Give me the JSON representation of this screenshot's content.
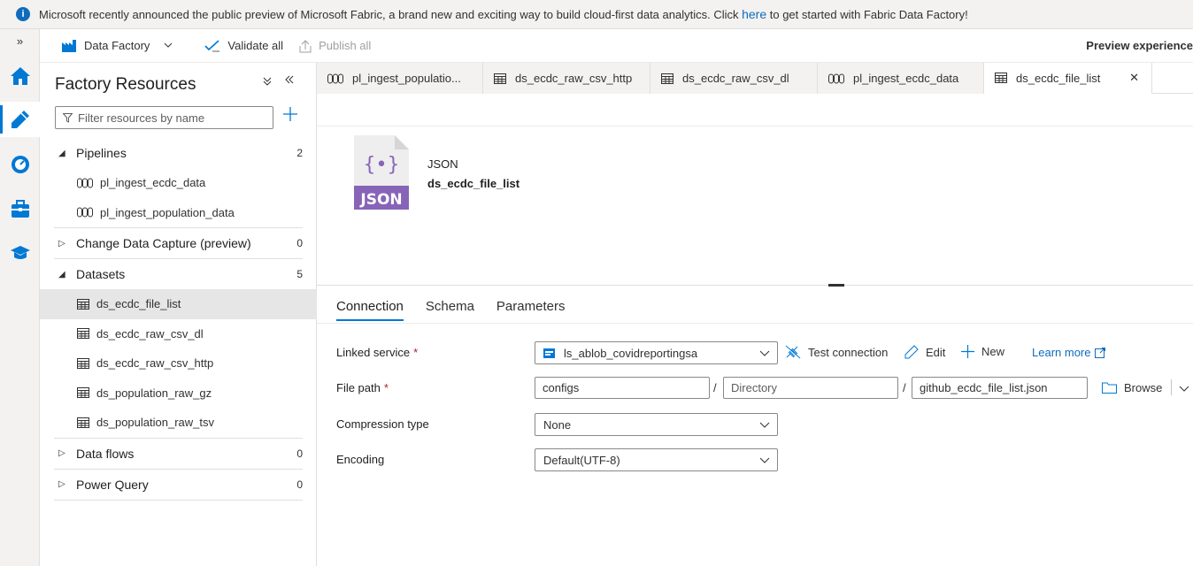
{
  "banner": {
    "text_before": "Microsoft recently announced the public preview of Microsoft Fabric, a brand new and exciting way to build cloud-first data analytics. Click ",
    "link": "here",
    "text_after": " to get started with Fabric Data Factory!"
  },
  "toolbar": {
    "factory_label": "Data Factory",
    "validate_label": "Validate all",
    "publish_label": "Publish all",
    "preview_label": "Preview experience"
  },
  "panel": {
    "title": "Factory Resources",
    "filter_placeholder": "Filter resources by name",
    "categories": [
      {
        "label": "Pipelines",
        "count": "2",
        "items": [
          "pl_ingest_ecdc_data",
          "pl_ingest_population_data"
        ]
      },
      {
        "label": "Change Data Capture (preview)",
        "count": "0"
      },
      {
        "label": "Datasets",
        "count": "5",
        "items": [
          "ds_ecdc_file_list",
          "ds_ecdc_raw_csv_dl",
          "ds_ecdc_raw_csv_http",
          "ds_population_raw_gz",
          "ds_population_raw_tsv"
        ]
      },
      {
        "label": "Data flows",
        "count": "0"
      },
      {
        "label": "Power Query",
        "count": "0"
      }
    ]
  },
  "tabs": [
    {
      "label": "pl_ingest_populatio...",
      "icon": "pipeline-icon"
    },
    {
      "label": "ds_ecdc_raw_csv_http",
      "icon": "dataset-icon"
    },
    {
      "label": "ds_ecdc_raw_csv_dl",
      "icon": "dataset-icon"
    },
    {
      "label": "pl_ingest_ecdc_data",
      "icon": "pipeline-icon"
    },
    {
      "label": "ds_ecdc_file_list",
      "icon": "dataset-icon"
    }
  ],
  "dataset": {
    "type": "JSON",
    "name": "ds_ecdc_file_list",
    "icon_text": "JSON",
    "icon_braces": "{•}"
  },
  "subtabs": [
    "Connection",
    "Schema",
    "Parameters"
  ],
  "form": {
    "linked_service_label": "Linked service",
    "linked_service_value": "ls_ablob_covidreportingsa",
    "test_connection": "Test connection",
    "edit": "Edit",
    "new": "New",
    "learn_more": "Learn more",
    "file_path_label": "File path",
    "file_path_container": "configs",
    "file_path_directory_placeholder": "Directory",
    "file_path_file": "github_ecdc_file_list.json",
    "browse": "Browse",
    "compression_label": "Compression type",
    "compression_value": "None",
    "encoding_label": "Encoding",
    "encoding_value": "Default(UTF-8)",
    "required_mark": "*"
  },
  "colors": {
    "accent": "#0078d4",
    "json_purple": "#8764b8",
    "banner_bg": "#f3f2f1"
  }
}
